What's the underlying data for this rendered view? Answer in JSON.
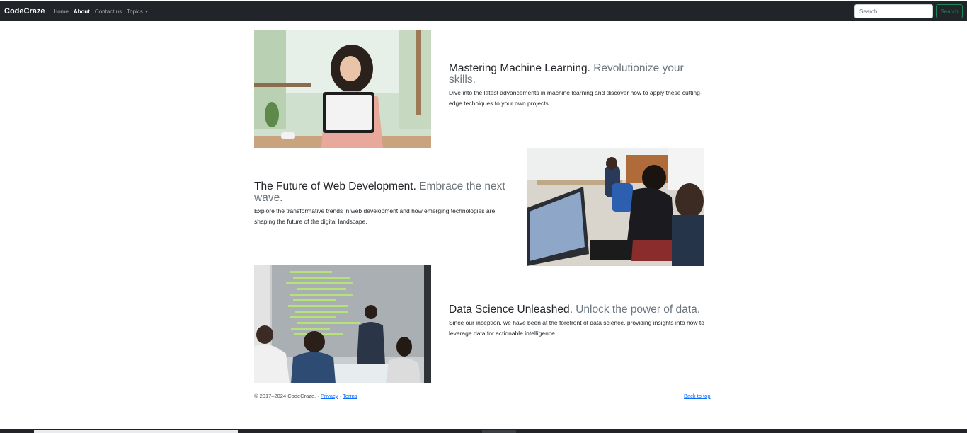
{
  "navbar": {
    "brand": "CodeCraze",
    "links": [
      {
        "label": "Home"
      },
      {
        "label": "About"
      },
      {
        "label": "Contact us"
      },
      {
        "label": "Topics"
      }
    ],
    "search_placeholder": "Search",
    "search_button": "Search"
  },
  "features": [
    {
      "heading": "Mastering Machine Learning.",
      "heading_muted": "Revolutionize your skills.",
      "lead": "Dive into the latest advancements in machine learning and discover how to apply these cutting-edge techniques to your own projects."
    },
    {
      "heading": "The Future of Web Development.",
      "heading_muted": "Embrace the next wave.",
      "lead": "Explore the transformative trends in web development and how emerging technologies are shaping the future of the digital landscape."
    },
    {
      "heading": "Data Science Unleashed.",
      "heading_muted": "Unlock the power of data.",
      "lead": "Since our inception, we have been at the forefront of data science, providing insights into how to leverage data for actionable intelligence."
    }
  ],
  "footer": {
    "copyright": "© 2017–2024 CodeCraze. · ",
    "privacy": "Privacy",
    "separator": " · ",
    "terms": "Terms",
    "back_to_top": "Back to top"
  },
  "colors": {
    "navbar_bg": "#212529",
    "success": "#198754",
    "link": "#0d6efd",
    "muted": "#6c757d"
  }
}
